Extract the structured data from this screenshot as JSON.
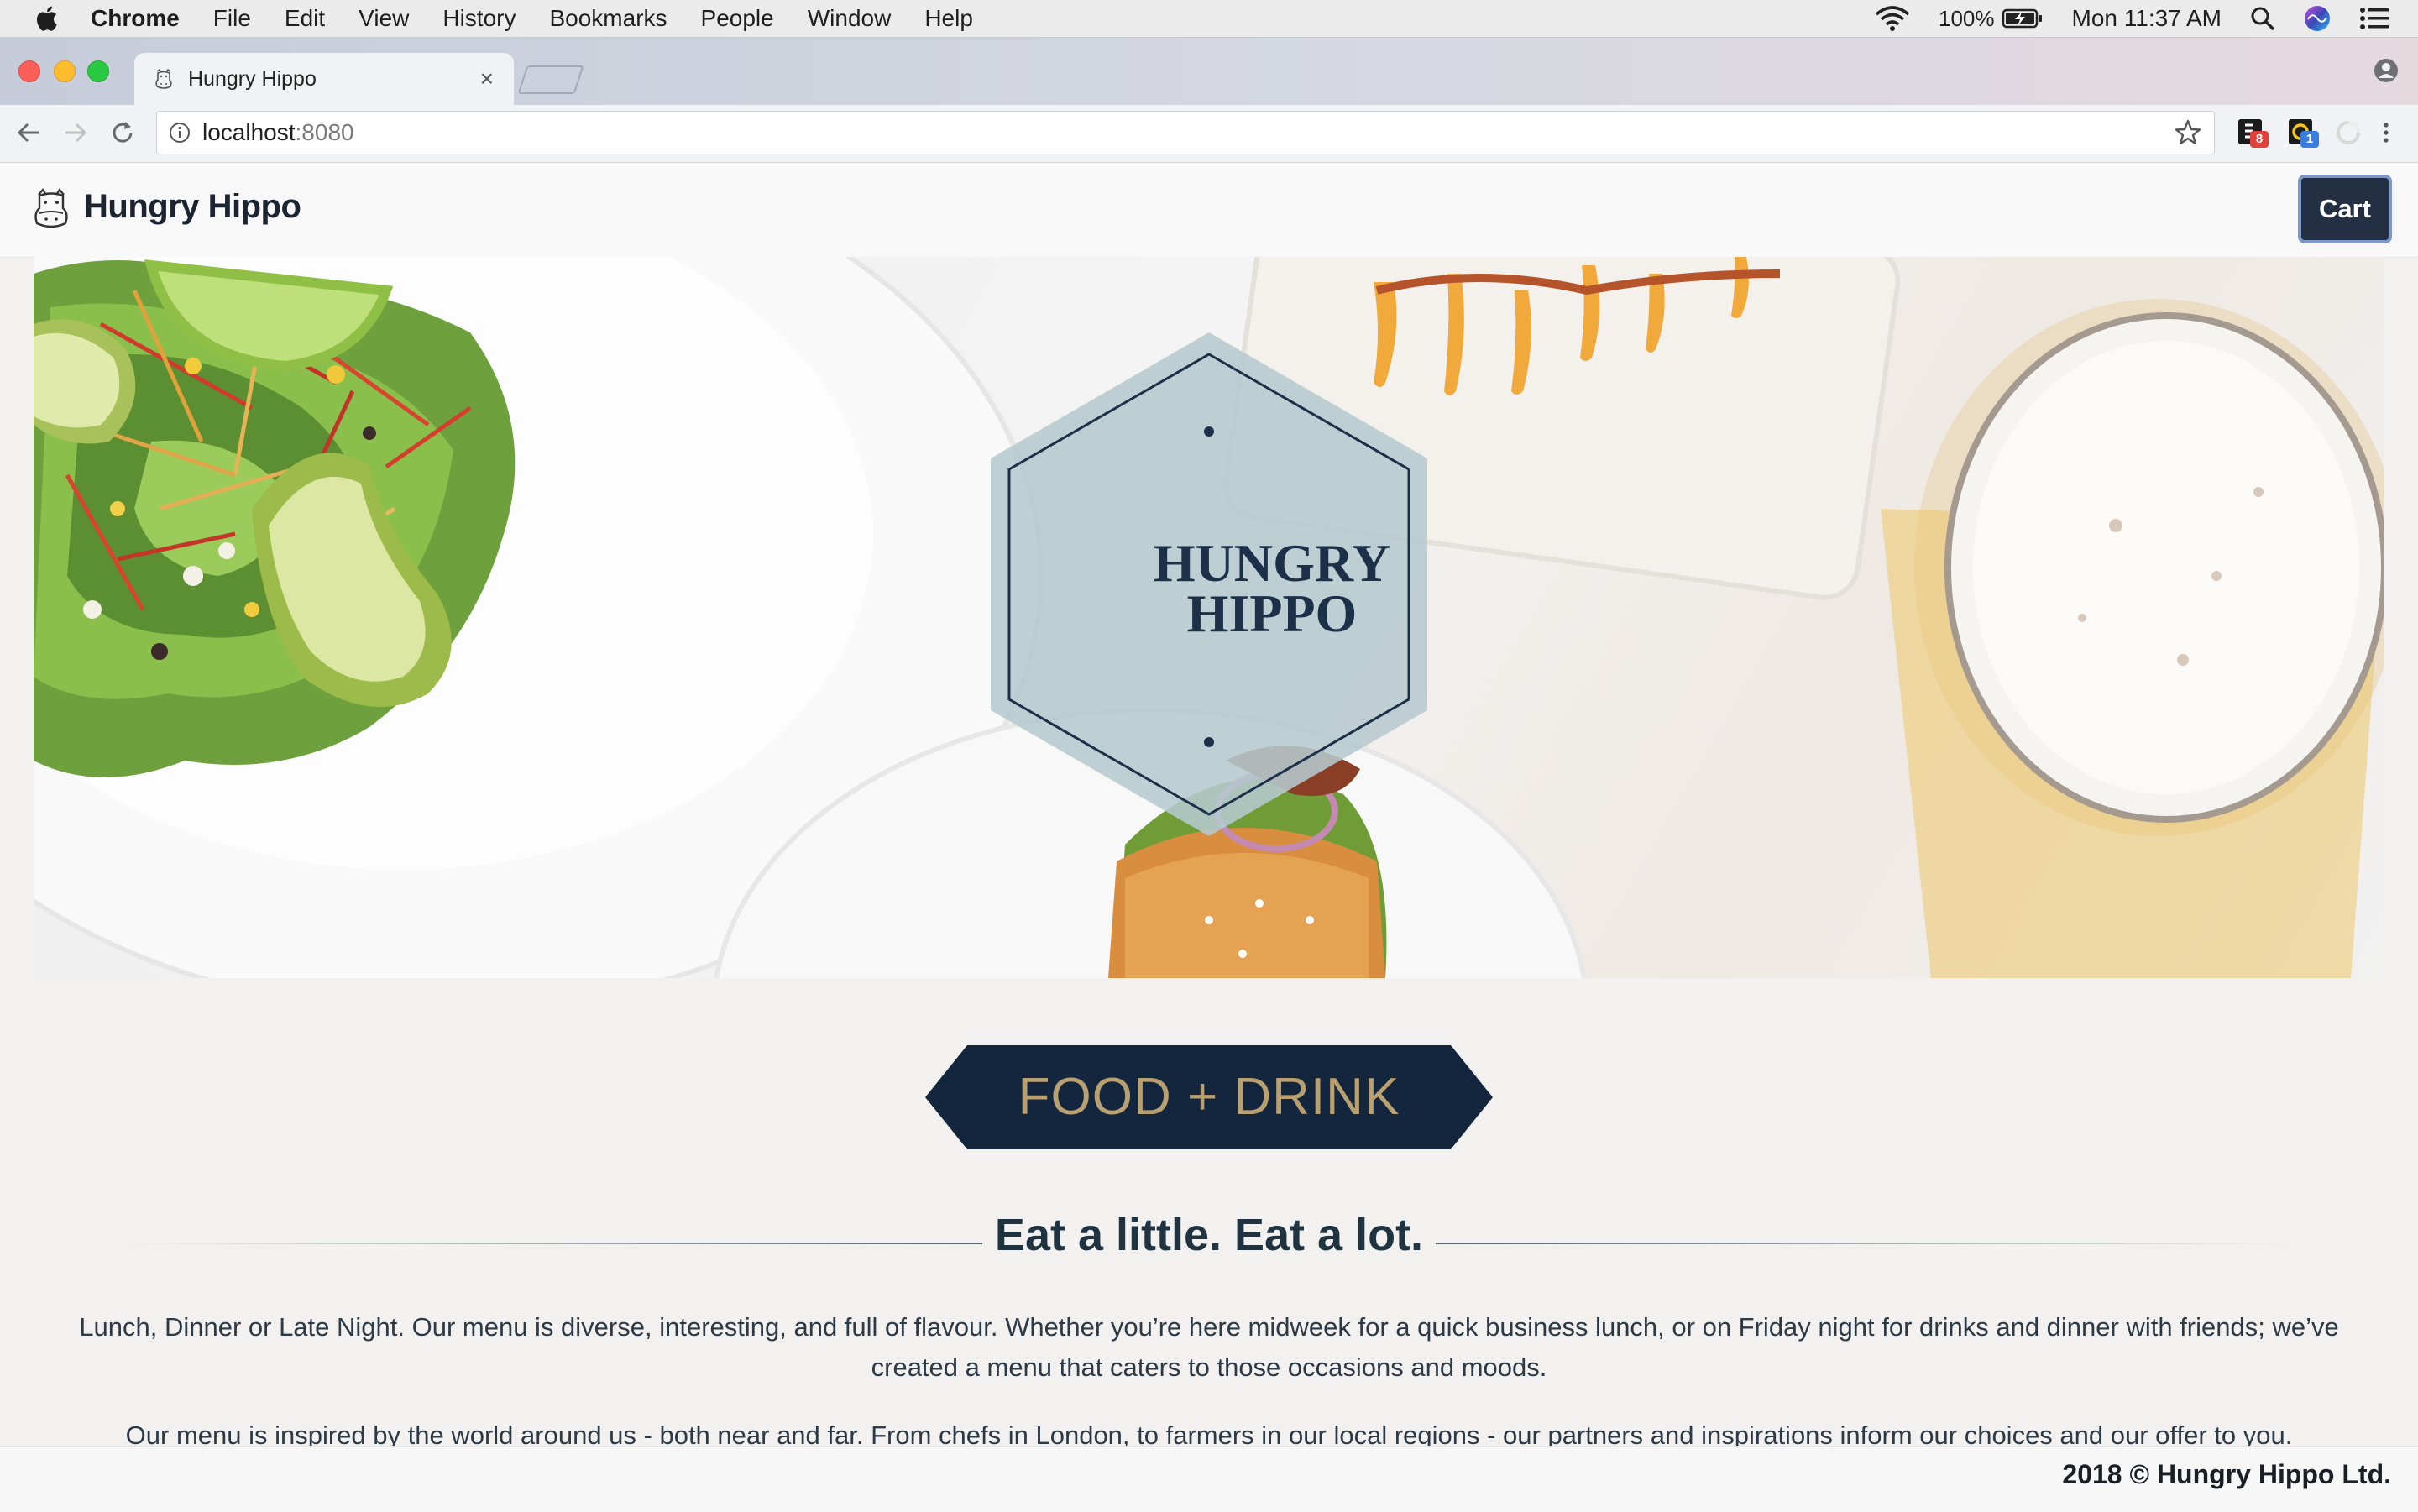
{
  "menubar": {
    "app_name": "Chrome",
    "items": [
      "File",
      "Edit",
      "View",
      "History",
      "Bookmarks",
      "People",
      "Window",
      "Help"
    ],
    "battery": "100%",
    "clock": "Mon 11:37 AM"
  },
  "browser": {
    "tab_title": "Hungry Hippo",
    "tab_close": "×",
    "url_host": "localhost",
    "url_port": ":8080",
    "extensions": [
      {
        "icon": "extension-icon",
        "badge": "8",
        "badge_color": "#e0413a"
      },
      {
        "icon": "extension-icon",
        "badge": "1",
        "badge_color": "#3a7de0"
      }
    ]
  },
  "site": {
    "brand_name": "Hungry Hippo",
    "cart_label": "Cart",
    "hero_title_line1": "HUNGRY",
    "hero_title_line2": "HIPPO",
    "section_title": "FOOD + DRINK",
    "headline": "Eat a little. Eat a lot.",
    "paragraph_1": "Lunch, Dinner or Late Night. Our menu is diverse, interesting, and full of flavour. Whether you’re here midweek for a quick business lunch, or on Friday night for drinks and dinner with friends; we’ve created a menu that caters to those occasions and moods.",
    "paragraph_2": "Our menu is inspired by the world around us - both near and far. From chefs in London, to farmers in our local regions  - our partners and inspirations inform our choices and our offer to you.",
    "footer": "2018 © Hungry Hippo Ltd."
  },
  "colors": {
    "navy": "#13263d",
    "gold": "#b8a070",
    "cart_bg": "#233044",
    "hexagon_fill": "#b6c9cf"
  }
}
